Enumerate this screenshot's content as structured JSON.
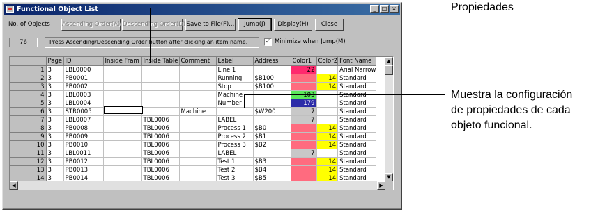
{
  "window": {
    "title": "Functional Object List",
    "controls": {
      "minimize": "_",
      "maximize": "□",
      "close": "×"
    }
  },
  "header": {
    "count_label": "No. of Objects",
    "count_value": "76",
    "hint": "Press Ascending/Descending Order button after clicking an item name.",
    "minimize_label": "Minimize when Jump(M)",
    "minimize_checked": "✓",
    "buttons": {
      "ascending": "Ascending Order(A)",
      "descending": "Descending Order(D)",
      "save": "Save to File(F)...",
      "jump": "Jump(J)",
      "display": "Display(H)",
      "close": "Close"
    }
  },
  "table": {
    "columns": [
      "",
      "Page",
      "ID",
      "Inside Fram",
      "Inside Table",
      "Comment",
      "Label",
      "Address",
      "Color1",
      "Color2",
      "Font Name"
    ],
    "rows": [
      {
        "n": "1",
        "page": "3",
        "id": "LBL0000",
        "frame": "",
        "tbl": "",
        "comment": "",
        "label": "Line 1",
        "addr": "",
        "c1": "22",
        "c1bg": "#ff2a6e",
        "c2": "",
        "c2bg": "",
        "font": "Arial Narrow"
      },
      {
        "n": "2",
        "page": "3",
        "id": "PB0001",
        "frame": "",
        "tbl": "",
        "comment": "",
        "label": "Running",
        "addr": "$B100",
        "c1": "",
        "c1bg": "#ff6b7f",
        "c2": "14",
        "c2bg": "#ffff00",
        "font": "Standard"
      },
      {
        "n": "3",
        "page": "3",
        "id": "PB0002",
        "frame": "",
        "tbl": "",
        "comment": "",
        "label": "Stop",
        "addr": "$B100",
        "c1": "",
        "c1bg": "#ff6b7f",
        "c2": "14",
        "c2bg": "#ffff00",
        "font": "Standard"
      },
      {
        "n": "4",
        "page": "3",
        "id": "LBL0003",
        "frame": "",
        "tbl": "",
        "comment": "",
        "label": "Machine",
        "addr": "",
        "c1": "103",
        "c1bg": "#5ce85c",
        "c2": "",
        "c2bg": "",
        "font": "Standard"
      },
      {
        "n": "5",
        "page": "3",
        "id": "LBL0004",
        "frame": "",
        "tbl": "",
        "comment": "",
        "label": "Number",
        "addr": "",
        "c1": "179",
        "c1bg": "#2c2ca8",
        "c2": "",
        "c2bg": "",
        "font": "Standard"
      },
      {
        "n": "6",
        "page": "3",
        "id": "STR0005",
        "frame": "",
        "tbl": "",
        "comment": "Machine",
        "label": "",
        "addr": "$W200",
        "c1": "7",
        "c1bg": "#c8c8c8",
        "c2": "",
        "c2bg": "",
        "font": "Standard"
      },
      {
        "n": "7",
        "page": "3",
        "id": "LBL0007",
        "frame": "",
        "tbl": "TBL0006",
        "comment": "",
        "label": "LABEL",
        "addr": "",
        "c1": "7",
        "c1bg": "#c8c8c8",
        "c2": "",
        "c2bg": "",
        "font": "Standard"
      },
      {
        "n": "8",
        "page": "3",
        "id": "PB0008",
        "frame": "",
        "tbl": "TBL0006",
        "comment": "",
        "label": "Process 1",
        "addr": "$B0",
        "c1": "",
        "c1bg": "#ff6b7f",
        "c2": "14",
        "c2bg": "#ffff00",
        "font": "Standard"
      },
      {
        "n": "9",
        "page": "3",
        "id": "PB0009",
        "frame": "",
        "tbl": "TBL0006",
        "comment": "",
        "label": "Process 2",
        "addr": "$B1",
        "c1": "",
        "c1bg": "#ff6b7f",
        "c2": "14",
        "c2bg": "#ffff00",
        "font": "Standard"
      },
      {
        "n": "10",
        "page": "3",
        "id": "PB0010",
        "frame": "",
        "tbl": "TBL0006",
        "comment": "",
        "label": "Process 3",
        "addr": "$B2",
        "c1": "",
        "c1bg": "#ff6b7f",
        "c2": "14",
        "c2bg": "#ffff00",
        "font": "Standard"
      },
      {
        "n": "11",
        "page": "3",
        "id": "LBL0011",
        "frame": "",
        "tbl": "TBL0006",
        "comment": "",
        "label": "LABEL",
        "addr": "",
        "c1": "7",
        "c1bg": "#c8c8c8",
        "c2": "",
        "c2bg": "",
        "font": "Standard"
      },
      {
        "n": "12",
        "page": "3",
        "id": "PB0012",
        "frame": "",
        "tbl": "TBL0006",
        "comment": "",
        "label": "Test 1",
        "addr": "$B3",
        "c1": "",
        "c1bg": "#ff6b7f",
        "c2": "14",
        "c2bg": "#ffff00",
        "font": "Standard"
      },
      {
        "n": "13",
        "page": "3",
        "id": "PB0013",
        "frame": "",
        "tbl": "TBL0006",
        "comment": "",
        "label": "Test 2",
        "addr": "$B4",
        "c1": "",
        "c1bg": "#ff6b7f",
        "c2": "14",
        "c2bg": "#ffff00",
        "font": "Standard"
      },
      {
        "n": "14",
        "page": "3",
        "id": "PB0014",
        "frame": "",
        "tbl": "TBL0006",
        "comment": "",
        "label": "Test 3",
        "addr": "$B5",
        "c1": "",
        "c1bg": "#ff6b7f",
        "c2": "14",
        "c2bg": "#ffff00",
        "font": "Standard"
      }
    ]
  },
  "callouts": {
    "properties": "Propiedades",
    "description": [
      "Muestra la configuración",
      "de propiedades de cada",
      "objeto funcional."
    ]
  },
  "colors": {
    "title_start": "#0a246a",
    "title_end": "#3a6ea5",
    "face": "#c0c0c0"
  },
  "icons": {
    "scroll_up": "▲",
    "scroll_down": "▼",
    "scroll_left": "◀",
    "scroll_right": "▶"
  }
}
